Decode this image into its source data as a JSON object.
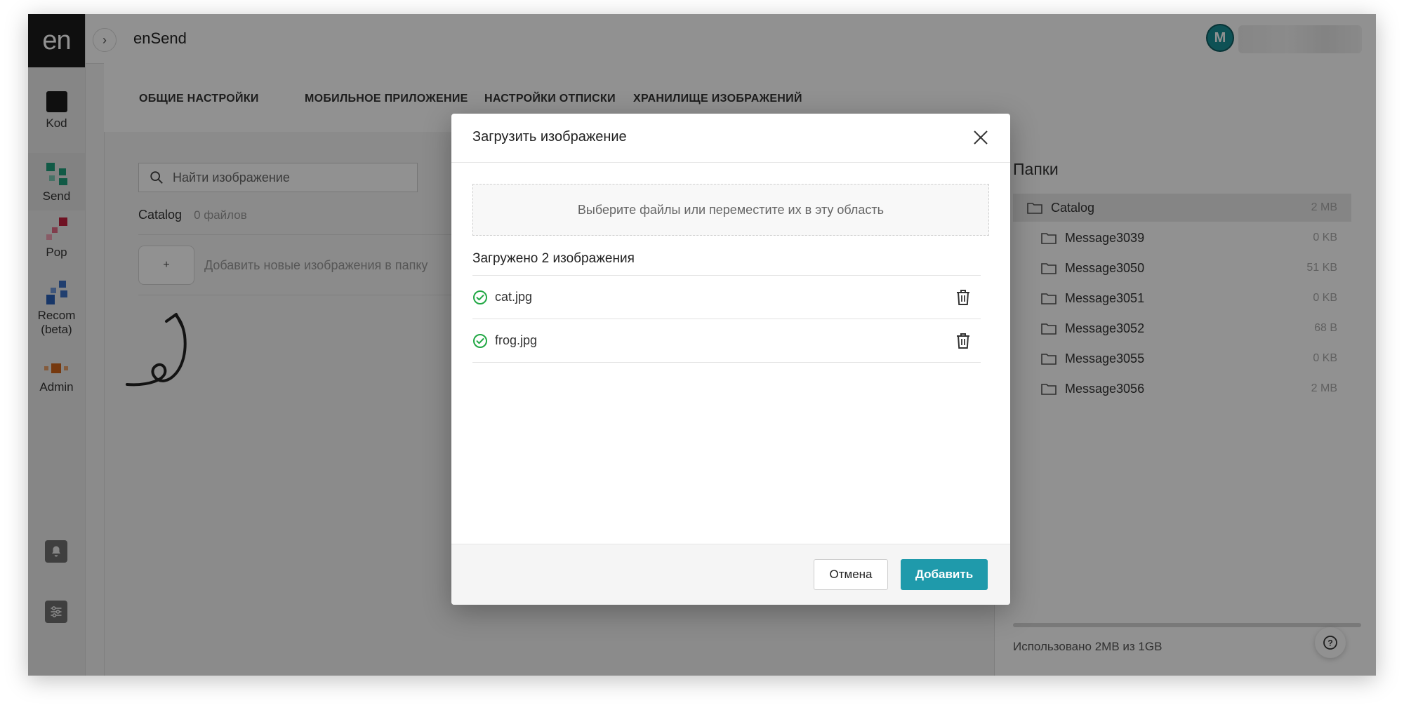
{
  "leftnav": {
    "logo": "en",
    "items": [
      {
        "label": "Kod"
      },
      {
        "label": "Send"
      },
      {
        "label": "Pop"
      },
      {
        "label": "Recom\n(beta)"
      },
      {
        "label": "Admin"
      }
    ]
  },
  "header": {
    "title": "enSend",
    "collapse_glyph": "›",
    "avatar_initial": "M"
  },
  "tabs": [
    {
      "label": "ОБЩИЕ НАСТРОЙКИ"
    },
    {
      "label": "МОБИЛЬНОЕ ПРИЛОЖЕНИЕ"
    },
    {
      "label": "НАСТРОЙКИ ОТПИСКИ"
    },
    {
      "label": "ХРАНИЛИЩЕ ИЗОБРАЖЕНИЙ"
    }
  ],
  "main": {
    "search_placeholder": "Найти изображение",
    "catalog_name": "Catalog",
    "catalog_count": "0 файлов",
    "add_plus": "+",
    "add_text": "Добавить новые изображения в папку"
  },
  "folders": {
    "title": "Папки",
    "items": [
      {
        "name": "Catalog",
        "size": "2 MB"
      },
      {
        "name": "Message3039",
        "size": "0 KB"
      },
      {
        "name": "Message3050",
        "size": "51 KB"
      },
      {
        "name": "Message3051",
        "size": "0 KB"
      },
      {
        "name": "Message3052",
        "size": "68 B"
      },
      {
        "name": "Message3055",
        "size": "0 KB"
      },
      {
        "name": "Message3056",
        "size": "2 MB"
      }
    ],
    "usage": "Использовано 2MB из 1GB",
    "help_glyph": "?"
  },
  "modal": {
    "title": "Загрузить изображение",
    "dropzone_text": "Выберите файлы или переместите их в эту область",
    "uploaded_title": "Загружено 2 изображения",
    "files": [
      {
        "name": "cat.jpg"
      },
      {
        "name": "frog.jpg"
      }
    ],
    "cancel_label": "Отмена",
    "add_label": "Добавить"
  },
  "colors": {
    "accent": "#1f9aab",
    "success": "#22a845",
    "avatar": "#1a8f96"
  }
}
